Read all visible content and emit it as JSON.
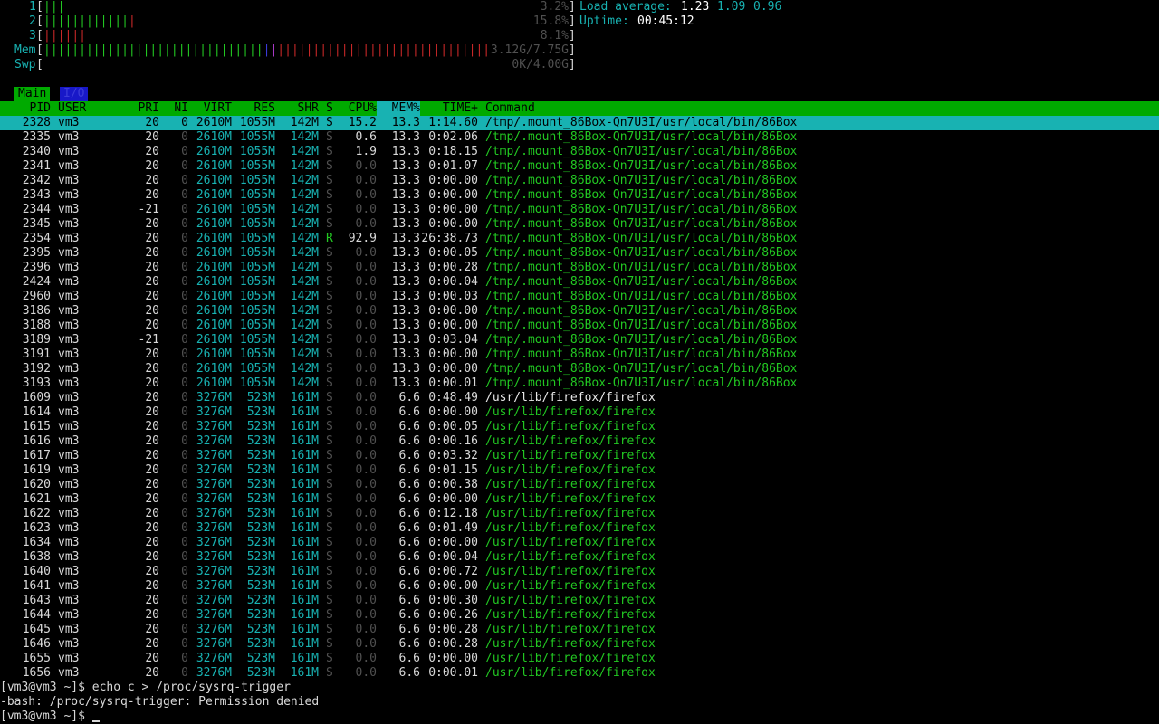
{
  "meters": {
    "cpu": [
      {
        "label": "1",
        "bars": "|||",
        "bar_colors": [
          "gr",
          "gr",
          "gr"
        ],
        "percent": "3.2%"
      },
      {
        "label": "2",
        "bars": "|||||||||||||",
        "bar_colors": [
          "gr",
          "gr",
          "gr",
          "gr",
          "gr",
          "gr",
          "gr",
          "gr",
          "gr",
          "gr",
          "gr",
          "gr",
          "rd"
        ],
        "percent": "15.8%"
      },
      {
        "label": "3",
        "bars": "||||||",
        "bar_colors": [
          "rd",
          "rd",
          "rd",
          "rd",
          "rd",
          "rd"
        ],
        "percent": "8.1%"
      }
    ],
    "mem": {
      "label": "Mem",
      "value": "3.12G/7.75G"
    },
    "swp": {
      "label": "Swp",
      "value": "0K/4.00G"
    },
    "load_label": "Load average:",
    "load_1": "1.23",
    "load_5": "1.09",
    "load_15": "0.96",
    "uptime_label": "Uptime:",
    "uptime": "00:45:12"
  },
  "tabs": {
    "main": "Main",
    "io": "I/O"
  },
  "columns": [
    "PID",
    "USER",
    "PRI",
    "NI",
    "VIRT",
    "RES",
    "SHR",
    "S",
    "CPU%",
    "MEM%",
    "TIME+",
    "Command"
  ],
  "processes": [
    {
      "pid": "2328",
      "user": "vm3",
      "pri": "20",
      "ni": "0",
      "virt": "2610M",
      "res": "1055M",
      "shr": "142M",
      "s": "S",
      "cpu": "15.2",
      "mem": "13.3",
      "time": "1:14.60",
      "cmd": "/tmp/.mount_86Box-Qn7U3I/usr/local/bin/86Box",
      "selected": true
    },
    {
      "pid": "2335",
      "user": "vm3",
      "pri": "20",
      "ni": "0",
      "virt": "2610M",
      "res": "1055M",
      "shr": "142M",
      "s": "S",
      "cpu": "0.6",
      "mem": "13.3",
      "time": "0:02.06",
      "cmd": "/tmp/.mount_86Box-Qn7U3I/usr/local/bin/86Box"
    },
    {
      "pid": "2340",
      "user": "vm3",
      "pri": "20",
      "ni": "0",
      "virt": "2610M",
      "res": "1055M",
      "shr": "142M",
      "s": "S",
      "cpu": "1.9",
      "mem": "13.3",
      "time": "0:18.15",
      "cmd": "/tmp/.mount_86Box-Qn7U3I/usr/local/bin/86Box"
    },
    {
      "pid": "2341",
      "user": "vm3",
      "pri": "20",
      "ni": "0",
      "virt": "2610M",
      "res": "1055M",
      "shr": "142M",
      "s": "S",
      "cpu": "0.0",
      "mem": "13.3",
      "time": "0:01.07",
      "cmd": "/tmp/.mount_86Box-Qn7U3I/usr/local/bin/86Box"
    },
    {
      "pid": "2342",
      "user": "vm3",
      "pri": "20",
      "ni": "0",
      "virt": "2610M",
      "res": "1055M",
      "shr": "142M",
      "s": "S",
      "cpu": "0.0",
      "mem": "13.3",
      "time": "0:00.00",
      "cmd": "/tmp/.mount_86Box-Qn7U3I/usr/local/bin/86Box"
    },
    {
      "pid": "2343",
      "user": "vm3",
      "pri": "20",
      "ni": "0",
      "virt": "2610M",
      "res": "1055M",
      "shr": "142M",
      "s": "S",
      "cpu": "0.0",
      "mem": "13.3",
      "time": "0:00.00",
      "cmd": "/tmp/.mount_86Box-Qn7U3I/usr/local/bin/86Box"
    },
    {
      "pid": "2344",
      "user": "vm3",
      "pri": "-21",
      "ni": "0",
      "virt": "2610M",
      "res": "1055M",
      "shr": "142M",
      "s": "S",
      "cpu": "0.0",
      "mem": "13.3",
      "time": "0:00.00",
      "cmd": "/tmp/.mount_86Box-Qn7U3I/usr/local/bin/86Box"
    },
    {
      "pid": "2345",
      "user": "vm3",
      "pri": "20",
      "ni": "0",
      "virt": "2610M",
      "res": "1055M",
      "shr": "142M",
      "s": "S",
      "cpu": "0.0",
      "mem": "13.3",
      "time": "0:00.00",
      "cmd": "/tmp/.mount_86Box-Qn7U3I/usr/local/bin/86Box"
    },
    {
      "pid": "2354",
      "user": "vm3",
      "pri": "20",
      "ni": "0",
      "virt": "2610M",
      "res": "1055M",
      "shr": "142M",
      "s": "R",
      "cpu": "92.9",
      "mem": "13.3",
      "time": "26:38.73",
      "cmd": "/tmp/.mount_86Box-Qn7U3I/usr/local/bin/86Box"
    },
    {
      "pid": "2395",
      "user": "vm3",
      "pri": "20",
      "ni": "0",
      "virt": "2610M",
      "res": "1055M",
      "shr": "142M",
      "s": "S",
      "cpu": "0.0",
      "mem": "13.3",
      "time": "0:00.05",
      "cmd": "/tmp/.mount_86Box-Qn7U3I/usr/local/bin/86Box"
    },
    {
      "pid": "2396",
      "user": "vm3",
      "pri": "20",
      "ni": "0",
      "virt": "2610M",
      "res": "1055M",
      "shr": "142M",
      "s": "S",
      "cpu": "0.0",
      "mem": "13.3",
      "time": "0:00.28",
      "cmd": "/tmp/.mount_86Box-Qn7U3I/usr/local/bin/86Box"
    },
    {
      "pid": "2424",
      "user": "vm3",
      "pri": "20",
      "ni": "0",
      "virt": "2610M",
      "res": "1055M",
      "shr": "142M",
      "s": "S",
      "cpu": "0.0",
      "mem": "13.3",
      "time": "0:00.04",
      "cmd": "/tmp/.mount_86Box-Qn7U3I/usr/local/bin/86Box"
    },
    {
      "pid": "2960",
      "user": "vm3",
      "pri": "20",
      "ni": "0",
      "virt": "2610M",
      "res": "1055M",
      "shr": "142M",
      "s": "S",
      "cpu": "0.0",
      "mem": "13.3",
      "time": "0:00.03",
      "cmd": "/tmp/.mount_86Box-Qn7U3I/usr/local/bin/86Box"
    },
    {
      "pid": "3186",
      "user": "vm3",
      "pri": "20",
      "ni": "0",
      "virt": "2610M",
      "res": "1055M",
      "shr": "142M",
      "s": "S",
      "cpu": "0.0",
      "mem": "13.3",
      "time": "0:00.00",
      "cmd": "/tmp/.mount_86Box-Qn7U3I/usr/local/bin/86Box"
    },
    {
      "pid": "3188",
      "user": "vm3",
      "pri": "20",
      "ni": "0",
      "virt": "2610M",
      "res": "1055M",
      "shr": "142M",
      "s": "S",
      "cpu": "0.0",
      "mem": "13.3",
      "time": "0:00.00",
      "cmd": "/tmp/.mount_86Box-Qn7U3I/usr/local/bin/86Box"
    },
    {
      "pid": "3189",
      "user": "vm3",
      "pri": "-21",
      "ni": "0",
      "virt": "2610M",
      "res": "1055M",
      "shr": "142M",
      "s": "S",
      "cpu": "0.0",
      "mem": "13.3",
      "time": "0:03.04",
      "cmd": "/tmp/.mount_86Box-Qn7U3I/usr/local/bin/86Box"
    },
    {
      "pid": "3191",
      "user": "vm3",
      "pri": "20",
      "ni": "0",
      "virt": "2610M",
      "res": "1055M",
      "shr": "142M",
      "s": "S",
      "cpu": "0.0",
      "mem": "13.3",
      "time": "0:00.00",
      "cmd": "/tmp/.mount_86Box-Qn7U3I/usr/local/bin/86Box"
    },
    {
      "pid": "3192",
      "user": "vm3",
      "pri": "20",
      "ni": "0",
      "virt": "2610M",
      "res": "1055M",
      "shr": "142M",
      "s": "S",
      "cpu": "0.0",
      "mem": "13.3",
      "time": "0:00.00",
      "cmd": "/tmp/.mount_86Box-Qn7U3I/usr/local/bin/86Box"
    },
    {
      "pid": "3193",
      "user": "vm3",
      "pri": "20",
      "ni": "0",
      "virt": "2610M",
      "res": "1055M",
      "shr": "142M",
      "s": "S",
      "cpu": "0.0",
      "mem": "13.3",
      "time": "0:00.01",
      "cmd": "/tmp/.mount_86Box-Qn7U3I/usr/local/bin/86Box"
    },
    {
      "pid": "1609",
      "user": "vm3",
      "pri": "20",
      "ni": "0",
      "virt": "3276M",
      "res": "523M",
      "shr": "161M",
      "s": "S",
      "cpu": "0.0",
      "mem": "6.6",
      "time": "0:48.49",
      "cmd": "/usr/lib/firefox/firefox",
      "main": true
    },
    {
      "pid": "1614",
      "user": "vm3",
      "pri": "20",
      "ni": "0",
      "virt": "3276M",
      "res": "523M",
      "shr": "161M",
      "s": "S",
      "cpu": "0.0",
      "mem": "6.6",
      "time": "0:00.00",
      "cmd": "/usr/lib/firefox/firefox"
    },
    {
      "pid": "1615",
      "user": "vm3",
      "pri": "20",
      "ni": "0",
      "virt": "3276M",
      "res": "523M",
      "shr": "161M",
      "s": "S",
      "cpu": "0.0",
      "mem": "6.6",
      "time": "0:00.05",
      "cmd": "/usr/lib/firefox/firefox"
    },
    {
      "pid": "1616",
      "user": "vm3",
      "pri": "20",
      "ni": "0",
      "virt": "3276M",
      "res": "523M",
      "shr": "161M",
      "s": "S",
      "cpu": "0.0",
      "mem": "6.6",
      "time": "0:00.16",
      "cmd": "/usr/lib/firefox/firefox"
    },
    {
      "pid": "1617",
      "user": "vm3",
      "pri": "20",
      "ni": "0",
      "virt": "3276M",
      "res": "523M",
      "shr": "161M",
      "s": "S",
      "cpu": "0.0",
      "mem": "6.6",
      "time": "0:03.32",
      "cmd": "/usr/lib/firefox/firefox"
    },
    {
      "pid": "1619",
      "user": "vm3",
      "pri": "20",
      "ni": "0",
      "virt": "3276M",
      "res": "523M",
      "shr": "161M",
      "s": "S",
      "cpu": "0.0",
      "mem": "6.6",
      "time": "0:01.15",
      "cmd": "/usr/lib/firefox/firefox"
    },
    {
      "pid": "1620",
      "user": "vm3",
      "pri": "20",
      "ni": "0",
      "virt": "3276M",
      "res": "523M",
      "shr": "161M",
      "s": "S",
      "cpu": "0.0",
      "mem": "6.6",
      "time": "0:00.38",
      "cmd": "/usr/lib/firefox/firefox"
    },
    {
      "pid": "1621",
      "user": "vm3",
      "pri": "20",
      "ni": "0",
      "virt": "3276M",
      "res": "523M",
      "shr": "161M",
      "s": "S",
      "cpu": "0.0",
      "mem": "6.6",
      "time": "0:00.00",
      "cmd": "/usr/lib/firefox/firefox"
    },
    {
      "pid": "1622",
      "user": "vm3",
      "pri": "20",
      "ni": "0",
      "virt": "3276M",
      "res": "523M",
      "shr": "161M",
      "s": "S",
      "cpu": "0.0",
      "mem": "6.6",
      "time": "0:12.18",
      "cmd": "/usr/lib/firefox/firefox"
    },
    {
      "pid": "1623",
      "user": "vm3",
      "pri": "20",
      "ni": "0",
      "virt": "3276M",
      "res": "523M",
      "shr": "161M",
      "s": "S",
      "cpu": "0.0",
      "mem": "6.6",
      "time": "0:01.49",
      "cmd": "/usr/lib/firefox/firefox"
    },
    {
      "pid": "1634",
      "user": "vm3",
      "pri": "20",
      "ni": "0",
      "virt": "3276M",
      "res": "523M",
      "shr": "161M",
      "s": "S",
      "cpu": "0.0",
      "mem": "6.6",
      "time": "0:00.00",
      "cmd": "/usr/lib/firefox/firefox"
    },
    {
      "pid": "1638",
      "user": "vm3",
      "pri": "20",
      "ni": "0",
      "virt": "3276M",
      "res": "523M",
      "shr": "161M",
      "s": "S",
      "cpu": "0.0",
      "mem": "6.6",
      "time": "0:00.04",
      "cmd": "/usr/lib/firefox/firefox"
    },
    {
      "pid": "1640",
      "user": "vm3",
      "pri": "20",
      "ni": "0",
      "virt": "3276M",
      "res": "523M",
      "shr": "161M",
      "s": "S",
      "cpu": "0.0",
      "mem": "6.6",
      "time": "0:00.72",
      "cmd": "/usr/lib/firefox/firefox"
    },
    {
      "pid": "1641",
      "user": "vm3",
      "pri": "20",
      "ni": "0",
      "virt": "3276M",
      "res": "523M",
      "shr": "161M",
      "s": "S",
      "cpu": "0.0",
      "mem": "6.6",
      "time": "0:00.00",
      "cmd": "/usr/lib/firefox/firefox"
    },
    {
      "pid": "1643",
      "user": "vm3",
      "pri": "20",
      "ni": "0",
      "virt": "3276M",
      "res": "523M",
      "shr": "161M",
      "s": "S",
      "cpu": "0.0",
      "mem": "6.6",
      "time": "0:00.30",
      "cmd": "/usr/lib/firefox/firefox"
    },
    {
      "pid": "1644",
      "user": "vm3",
      "pri": "20",
      "ni": "0",
      "virt": "3276M",
      "res": "523M",
      "shr": "161M",
      "s": "S",
      "cpu": "0.0",
      "mem": "6.6",
      "time": "0:00.26",
      "cmd": "/usr/lib/firefox/firefox"
    },
    {
      "pid": "1645",
      "user": "vm3",
      "pri": "20",
      "ni": "0",
      "virt": "3276M",
      "res": "523M",
      "shr": "161M",
      "s": "S",
      "cpu": "0.0",
      "mem": "6.6",
      "time": "0:00.28",
      "cmd": "/usr/lib/firefox/firefox"
    },
    {
      "pid": "1646",
      "user": "vm3",
      "pri": "20",
      "ni": "0",
      "virt": "3276M",
      "res": "523M",
      "shr": "161M",
      "s": "S",
      "cpu": "0.0",
      "mem": "6.6",
      "time": "0:00.28",
      "cmd": "/usr/lib/firefox/firefox"
    },
    {
      "pid": "1655",
      "user": "vm3",
      "pri": "20",
      "ni": "0",
      "virt": "3276M",
      "res": "523M",
      "shr": "161M",
      "s": "S",
      "cpu": "0.0",
      "mem": "6.6",
      "time": "0:00.00",
      "cmd": "/usr/lib/firefox/firefox"
    },
    {
      "pid": "1656",
      "user": "vm3",
      "pri": "20",
      "ni": "0",
      "virt": "3276M",
      "res": "523M",
      "shr": "161M",
      "s": "S",
      "cpu": "0.0",
      "mem": "6.6",
      "time": "0:00.01",
      "cmd": "/usr/lib/firefox/firefox"
    }
  ],
  "terminal": {
    "line1": "[vm3@vm3 ~]$ echo c > /proc/sysrq-trigger",
    "line2": "-bash: /proc/sysrq-trigger: Permission denied",
    "prompt": "[vm3@vm3 ~]$ "
  },
  "colors": {
    "background": "#000000",
    "header_bg": "#00aa00",
    "selected_bg": "#18b2b2",
    "cyan": "#18b2b2",
    "green": "#22c822",
    "red": "#c82828",
    "blue": "#3b3bd8"
  }
}
